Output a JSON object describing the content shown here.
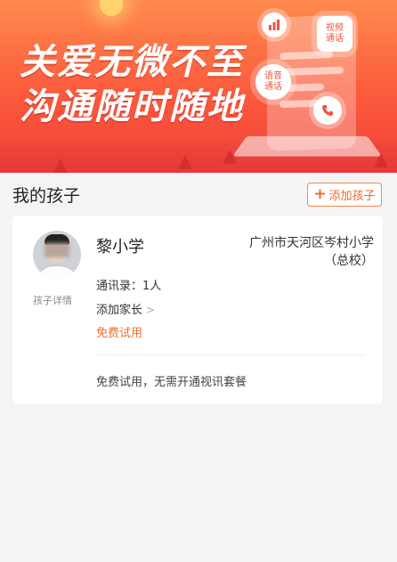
{
  "banner": {
    "slogan_line1": "关爱无微不至",
    "slogan_line2": "沟通随时随地",
    "bubble_video": "视频\n通话",
    "bubble_voice": "语音\n通话",
    "icons": [
      "chart-icon",
      "phone-icon"
    ],
    "colors": {
      "top": "#ff8a4e",
      "bottom": "#f0413a"
    }
  },
  "section": {
    "title": "我的孩子",
    "add_child_label": "添加孩子"
  },
  "child": {
    "name": "黎小学",
    "school": "广州市天河区岑村小学\n（总校）",
    "detail_label": "孩子详情",
    "contacts": "通讯录：1人",
    "add_parent": "添加家长",
    "trial_label": "免费试用",
    "trial_note": "免费试用，无需开通视讯套餐"
  },
  "accent_color": "#f06b2c"
}
